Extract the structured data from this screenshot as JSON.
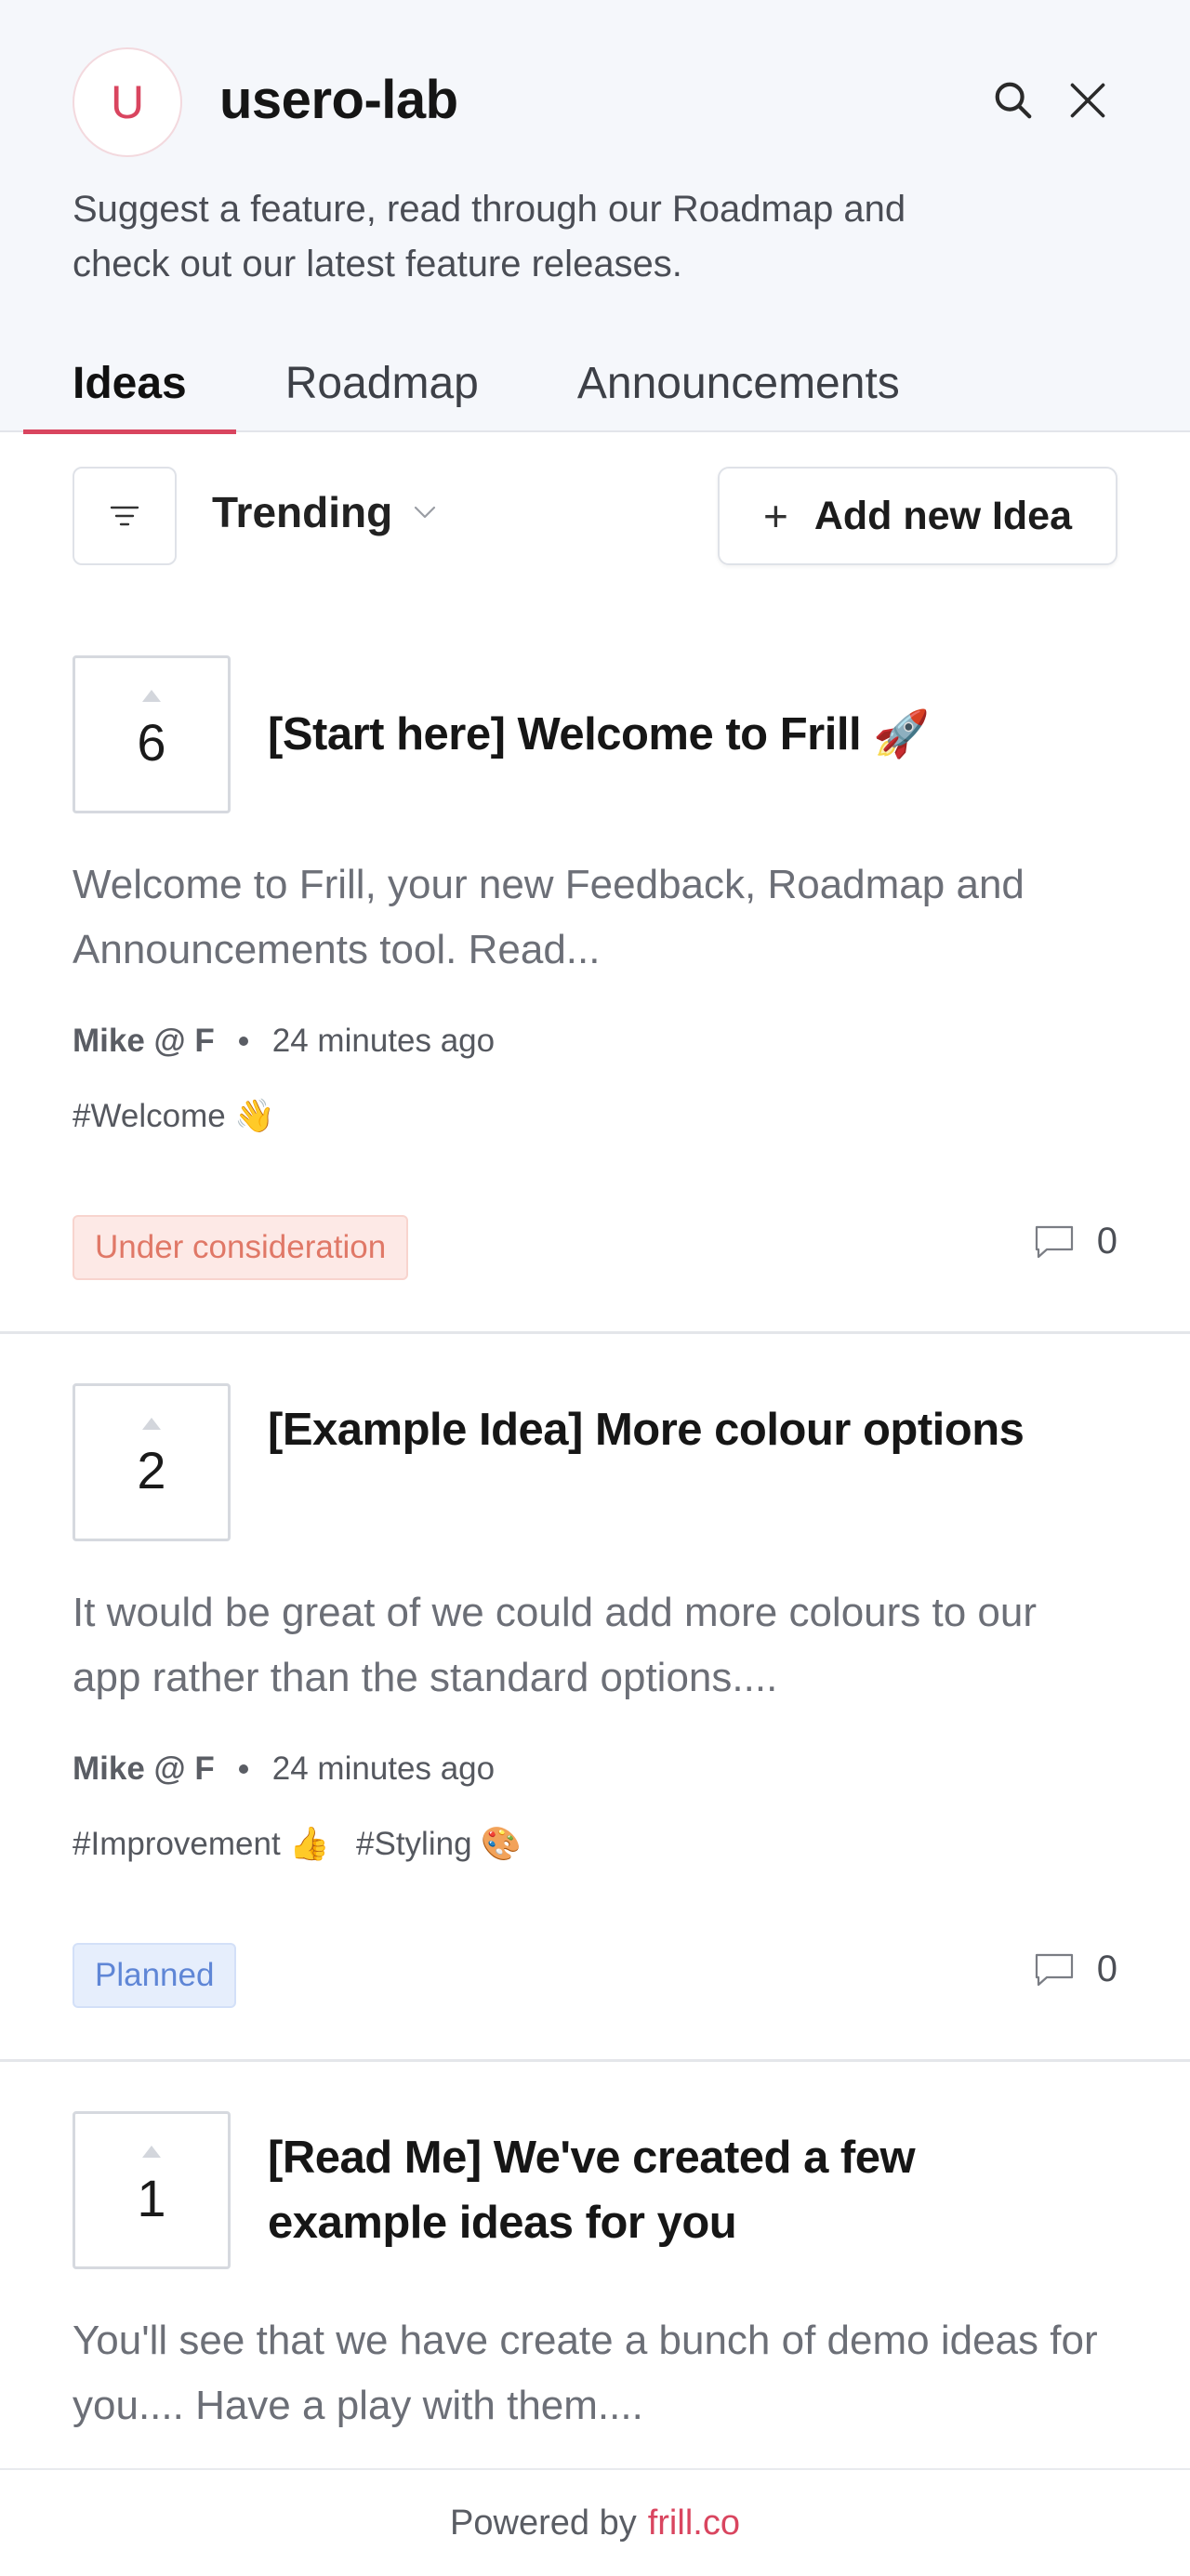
{
  "header": {
    "avatar_letter": "U",
    "workspace_name": "usero-lab",
    "subtitle": "Suggest a feature, read through our Roadmap and check out our latest feature releases.",
    "search_icon": "search-icon",
    "close_icon": "close-icon"
  },
  "tabs": [
    {
      "label": "Ideas",
      "active": true
    },
    {
      "label": "Roadmap",
      "active": false
    },
    {
      "label": "Announcements",
      "active": false
    }
  ],
  "toolbar": {
    "sort_label": "Trending",
    "add_label": "Add new Idea",
    "add_icon": "+"
  },
  "ideas": [
    {
      "votes": "6",
      "title": "[Start here] Welcome to Frill 🚀",
      "description": "Welcome to Frill, your new Feedback, Roadmap and Announcements tool. Read...",
      "author": "Mike @ F",
      "time": "24 minutes ago",
      "tags": [
        "#Welcome 👋"
      ],
      "status": "Under consideration",
      "comments": "0"
    },
    {
      "votes": "2",
      "title": "[Example Idea] More colour options",
      "description": "It would be great of we could add more colours to our app rather than the standard options....",
      "author": "Mike @ F",
      "time": "24 minutes ago",
      "tags": [
        "#Improvement 👍",
        "#Styling 🎨"
      ],
      "status": "Planned",
      "comments": "0"
    },
    {
      "votes": "1",
      "title": "[Read Me] We've created a few example ideas for you",
      "description": "You'll see that we have create a bunch of demo ideas for you.... Have a play with them...."
    }
  ],
  "footer": {
    "powered_by": "Powered by",
    "link_text": "frill.co"
  },
  "colors": {
    "accent": "#d9455f",
    "header_bg": "#f5f7fb",
    "status_consider": "#e07867",
    "status_planned": "#5f86d6"
  }
}
